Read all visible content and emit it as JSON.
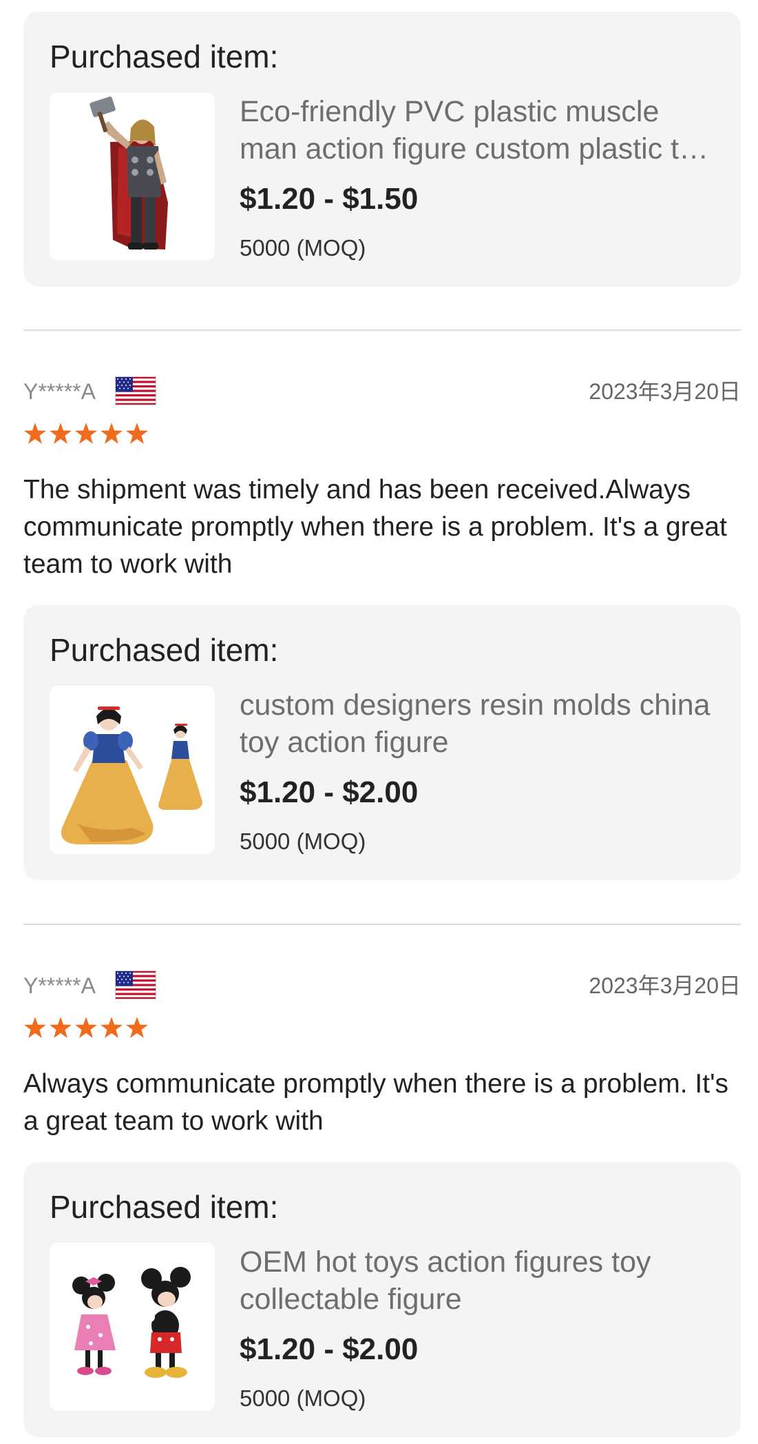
{
  "purchased_label": "Purchased item:",
  "items": [
    {
      "name": "Eco-friendly PVC plastic muscle man action figure custom plastic toy action figure",
      "price": "$1.20 - $1.50",
      "moq": "5000 (MOQ)",
      "image_icon": "hero-figure-icon"
    },
    {
      "name": "custom designers resin molds china toy action figure",
      "price": "$1.20 - $2.00",
      "moq": "5000 (MOQ)",
      "image_icon": "princess-figure-icon"
    },
    {
      "name": "OEM hot toys action figures toy collectable figure",
      "price": "$1.20 - $2.00",
      "moq": "5000 (MOQ)",
      "image_icon": "mouse-figures-icon"
    }
  ],
  "reviews": [
    {
      "username": "Y*****A",
      "country_flag": "us-flag-icon",
      "date": "2023年3月20日",
      "rating": 5,
      "text": "The shipment was timely and has been received.Always communicate promptly when there is a problem. It's a great team to work with"
    },
    {
      "username": "Y*****A",
      "country_flag": "us-flag-icon",
      "date": "2023年3月20日",
      "rating": 5,
      "text": "Always communicate promptly when there is a problem. It's a great team to work with"
    }
  ],
  "colors": {
    "star": "#f26b1d",
    "card_background": "#f4f4f4",
    "divider": "#dcdcdc",
    "item_name": "#6e6e6e"
  }
}
